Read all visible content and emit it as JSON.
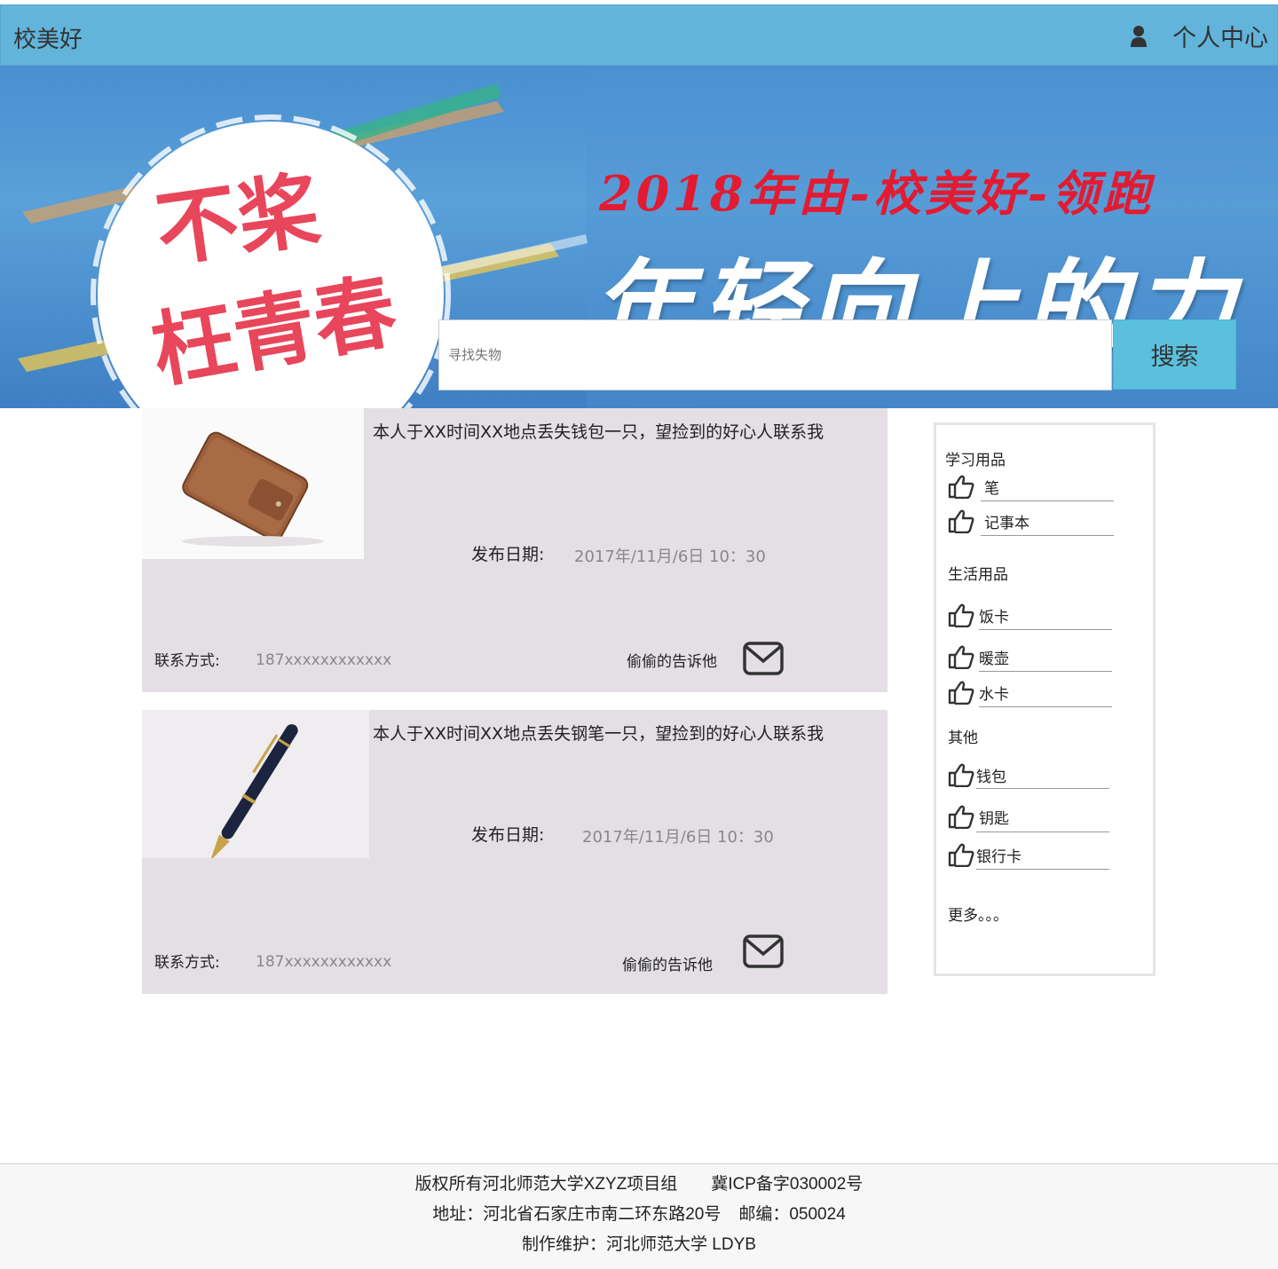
{
  "nav": {
    "brand": "校美好",
    "user_icon": "user-icon",
    "user_center": "个人中心"
  },
  "banner": {
    "circle_line1": "不桨",
    "circle_line2": "枉青春",
    "subtitle": "2018年由-校美好-领跑",
    "headline": "年轻向上的力量"
  },
  "search": {
    "placeholder": "寻找失物",
    "button": "搜索"
  },
  "posts": [
    {
      "image": "wallet",
      "description": "本人于XX时间XX地点丢失钱包一只，望捡到的好心人联系我",
      "date_label": "发布日期:",
      "date": "2017年/11月/6日 10：30",
      "contact_label": "联系方式:",
      "contact": "187xxxxxxxxxxxx",
      "tell_label": "偷偷的告诉他",
      "mail_icon": "mail-icon"
    },
    {
      "image": "fountain-pen",
      "description": "本人于XX时间XX地点丢失钢笔一只，望捡到的好心人联系我",
      "date_label": "发布日期:",
      "date": "2017年/11月/6日 10：30",
      "contact_label": "联系方式:",
      "contact": "187xxxxxxxxxxxx",
      "tell_label": "偷偷的告诉他",
      "mail_icon": "mail-icon"
    }
  ],
  "sidebar": {
    "item_icon": "thumbs-up-icon",
    "categories": [
      {
        "title": "学习用品",
        "items": [
          "笔",
          "记事本"
        ]
      },
      {
        "title": "生活用品",
        "items": [
          "饭卡",
          "暖壶",
          "水卡"
        ]
      },
      {
        "title": "其他",
        "items": [
          "钱包",
          "钥匙",
          "银行卡"
        ]
      }
    ],
    "more": "更多。。。"
  },
  "footer": {
    "copyright": "版权所有河北师范大学XZYZ项目组",
    "icp": "冀ICP备字030002号",
    "address": "地址：河北省石家庄市南二环东路20号",
    "postcode": "邮编：050024",
    "maintainer": "制作维护：河北师范大学 LDYB"
  }
}
